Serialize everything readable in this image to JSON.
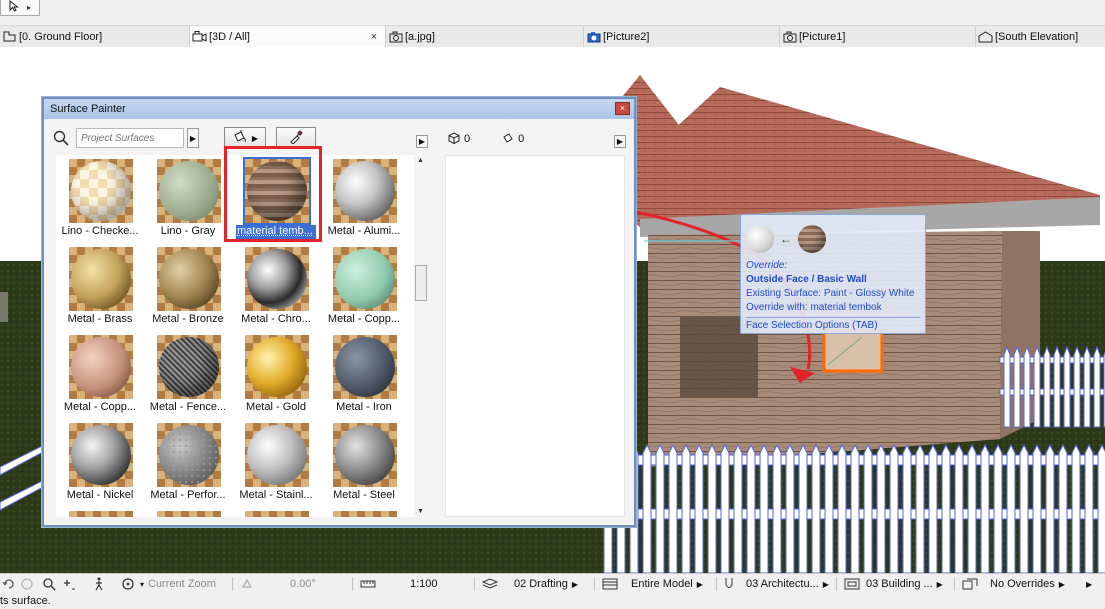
{
  "toolbar": {
    "arrow_tool": "arrow-cursor"
  },
  "tabs": [
    {
      "label": "[0. Ground Floor]",
      "icon": "floor-plan-icon"
    },
    {
      "label": "[3D / All]",
      "icon": "3d-camera-icon",
      "active": true,
      "close": "×"
    },
    {
      "label": "[a.jpg]",
      "icon": "camera-icon"
    },
    {
      "label": "[Picture2]",
      "icon": "camera-blue-icon"
    },
    {
      "label": "[Picture1]",
      "icon": "camera-icon"
    },
    {
      "label": "[South Elevation]",
      "icon": "elevation-icon"
    }
  ],
  "tab_marker": "----",
  "palette": {
    "title": "Surface Painter",
    "close": "×",
    "search_placeholder": "Project Surfaces",
    "counts": {
      "elements": "0",
      "surfaces": "0"
    },
    "materials": [
      {
        "label": "Lino - Checke...",
        "kind": "checker"
      },
      {
        "label": "Lino - Gray",
        "kind": "greengray"
      },
      {
        "label": "material temb...",
        "kind": "wood",
        "selected": true
      },
      {
        "label": "Metal - Alumi...",
        "kind": "alu"
      },
      {
        "label": "Metal - Brass",
        "kind": "brass"
      },
      {
        "label": "Metal - Bronze",
        "kind": "bronze"
      },
      {
        "label": "Metal - Chro...",
        "kind": "chrome"
      },
      {
        "label": "Metal - Copp...",
        "kind": "copper-green"
      },
      {
        "label": "Metal - Copp...",
        "kind": "copper"
      },
      {
        "label": "Metal - Fence...",
        "kind": "fence"
      },
      {
        "label": "Metal - Gold",
        "kind": "gold"
      },
      {
        "label": "Metal - Iron",
        "kind": "iron"
      },
      {
        "label": "Metal - Nickel",
        "kind": "nickel"
      },
      {
        "label": "Metal - Perfor...",
        "kind": "perforated"
      },
      {
        "label": "Metal - Stainl...",
        "kind": "stainless"
      },
      {
        "label": "Metal - Steel",
        "kind": "steel"
      }
    ]
  },
  "tooltip": {
    "override": "Override:",
    "target": "Outside Face / Basic Wall",
    "existing": "Existing Surface: Paint - Glossy White",
    "override_with": "Override with: material tembok",
    "options": "Face Selection Options (TAB)",
    "arrow": "←"
  },
  "statusbar": {
    "zoom_label": "Current Zoom",
    "angle": "0.00°",
    "scale": "1:100",
    "layer_combo": "02 Drafting",
    "model_view": "Entire Model",
    "pen_set": "03 Architectu...",
    "mvo": "03 Building ...",
    "overrides": "No Overrides"
  },
  "hint": "ts surface."
}
